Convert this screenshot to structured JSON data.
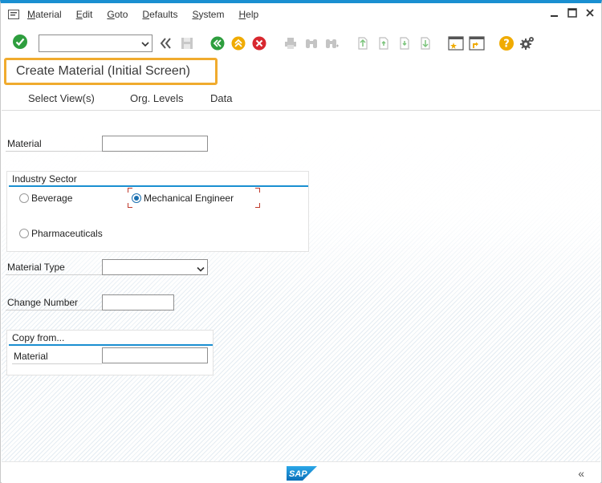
{
  "menubar": {
    "items": [
      {
        "label": "Material",
        "mnemonic": "M",
        "rest": "aterial"
      },
      {
        "label": "Edit",
        "mnemonic": "E",
        "rest": "dit"
      },
      {
        "label": "Goto",
        "mnemonic": "G",
        "rest": "oto"
      },
      {
        "label": "Defaults",
        "mnemonic": "D",
        "rest": "efaults"
      },
      {
        "label": "System",
        "mnemonic": "S",
        "rest": "ystem"
      },
      {
        "label": "Help",
        "mnemonic": "H",
        "rest": "elp"
      }
    ]
  },
  "toolbar": {
    "command_field_value": "",
    "icons": [
      "enter-icon",
      "command-dropdown-icon",
      "collapse-icon",
      "save-icon",
      "back-icon",
      "exit-icon",
      "cancel-icon",
      "print-icon",
      "find-icon",
      "find-next-icon",
      "first-page-icon",
      "previous-page-icon",
      "next-page-icon",
      "last-page-icon",
      "new-session-icon",
      "shortcut-icon",
      "help-icon",
      "settings-icon"
    ]
  },
  "title": "Create Material (Initial Screen)",
  "app_toolbar": {
    "buttons": [
      "Select View(s)",
      "Org. Levels",
      "Data"
    ]
  },
  "form": {
    "material_label": "Material",
    "material_value": "",
    "industry_sector": {
      "title": "Industry Sector",
      "options": [
        "Beverage",
        "Mechanical Engineer",
        "Pharmaceuticals"
      ],
      "selected": "Mechanical Engineer"
    },
    "material_type_label": "Material Type",
    "material_type_value": "",
    "change_number_label": "Change Number",
    "change_number_value": "",
    "copy_from": {
      "title": "Copy from...",
      "material_label": "Material",
      "material_value": ""
    }
  },
  "statusbar": {
    "logo_text": "SAP",
    "expand_glyph": "«"
  },
  "colors": {
    "accent_blue": "#1a8fd1",
    "title_highlight": "#f0ab2e",
    "enter_green": "#2e9e3e",
    "cancel_red": "#d8282f",
    "help_orange": "#f0ab00"
  }
}
